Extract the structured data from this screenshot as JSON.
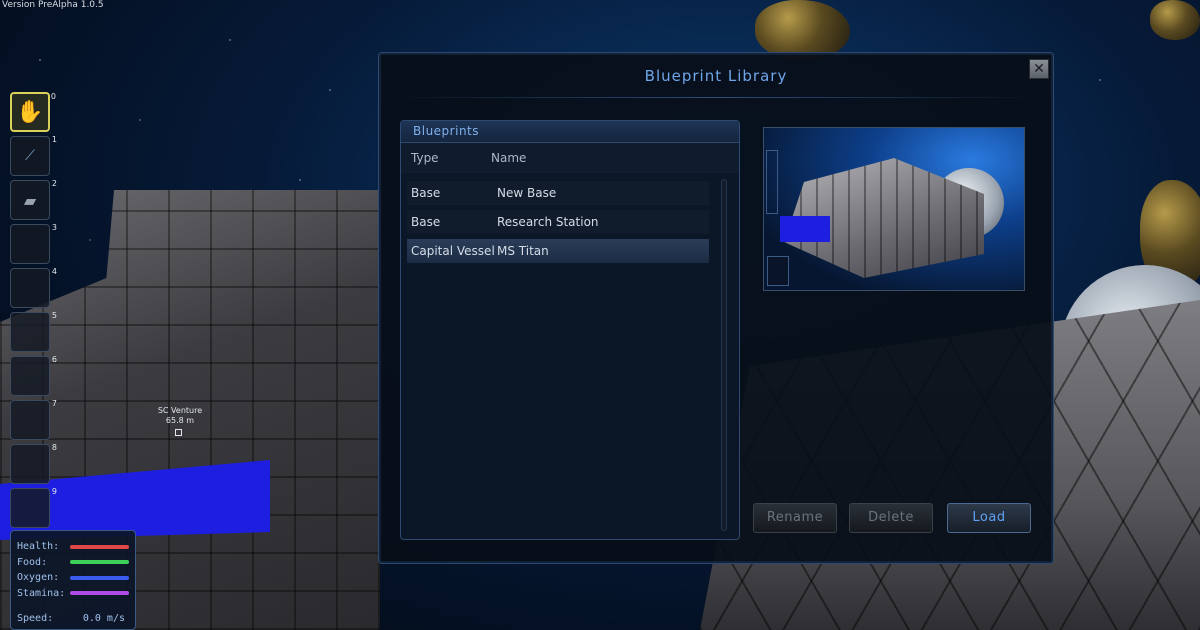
{
  "version_text": "Version PreAlpha 1.0.5",
  "world_label": {
    "name": "SC Venture",
    "distance": "65.8 m"
  },
  "hotbar": {
    "slots": [
      {
        "num": "0",
        "icon": "hand-icon",
        "selected": true
      },
      {
        "num": "1",
        "icon": "tool-icon"
      },
      {
        "num": "2",
        "icon": "gun-icon"
      },
      {
        "num": "3"
      },
      {
        "num": "4"
      },
      {
        "num": "5"
      },
      {
        "num": "6"
      },
      {
        "num": "7"
      },
      {
        "num": "8"
      },
      {
        "num": "9"
      }
    ]
  },
  "status": {
    "health_label": "Health:",
    "food_label": "Food:",
    "oxygen_label": "Oxygen:",
    "stamina_label": "Stamina:",
    "speed_label": "Speed:",
    "speed_value": "0.0 m/s",
    "colors": {
      "health": "#e04848",
      "food": "#3ecf5a",
      "oxygen": "#3b5cf0",
      "stamina": "#b04ae8"
    }
  },
  "dialog": {
    "title": "Blueprint Library",
    "close_label": "✕",
    "panel_title": "Blueprints",
    "col_type": "Type",
    "col_name": "Name",
    "rows": [
      {
        "type": "Base",
        "name": "New Base"
      },
      {
        "type": "Base",
        "name": "Research Station"
      },
      {
        "type": "Capital Vessel",
        "name": "MS Titan",
        "selected": true
      }
    ],
    "rename_label": "Rename",
    "delete_label": "Delete",
    "load_label": "Load"
  }
}
